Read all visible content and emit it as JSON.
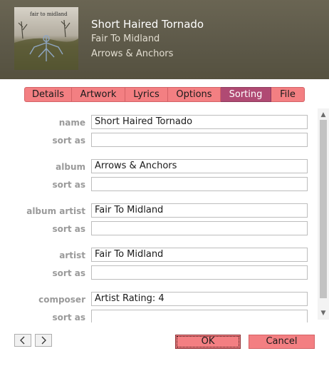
{
  "header": {
    "title": "Short Haired Tornado",
    "artist": "Fair To Midland",
    "album": "Arrows & Anchors",
    "artwork_text": "fair to midland"
  },
  "tabs": [
    {
      "label": "Details",
      "active": false
    },
    {
      "label": "Artwork",
      "active": false
    },
    {
      "label": "Lyrics",
      "active": false
    },
    {
      "label": "Options",
      "active": false
    },
    {
      "label": "Sorting",
      "active": true
    },
    {
      "label": "File",
      "active": false
    }
  ],
  "form": {
    "name_label": "name",
    "name_value": "Short Haired Tornado",
    "name_sort_label": "sort as",
    "name_sort_value": "",
    "album_label": "album",
    "album_value": "Arrows & Anchors",
    "album_sort_label": "sort as",
    "album_sort_value": "",
    "album_artist_label": "album artist",
    "album_artist_value": "Fair To Midland",
    "album_artist_sort_label": "sort as",
    "album_artist_sort_value": "",
    "artist_label": "artist",
    "artist_value": "Fair To Midland",
    "artist_sort_label": "sort as",
    "artist_sort_value": "",
    "composer_label": "composer",
    "composer_value": "Artist Rating: 4",
    "composer_sort_label": "sort as",
    "composer_sort_value": ""
  },
  "buttons": {
    "prev_icon": "chevron-left-icon",
    "next_icon": "chevron-right-icon",
    "ok": "OK",
    "cancel": "Cancel"
  },
  "colors": {
    "accent": "#f37f82",
    "active_tab": "#b04a73",
    "header_bg": "#5c5848"
  }
}
